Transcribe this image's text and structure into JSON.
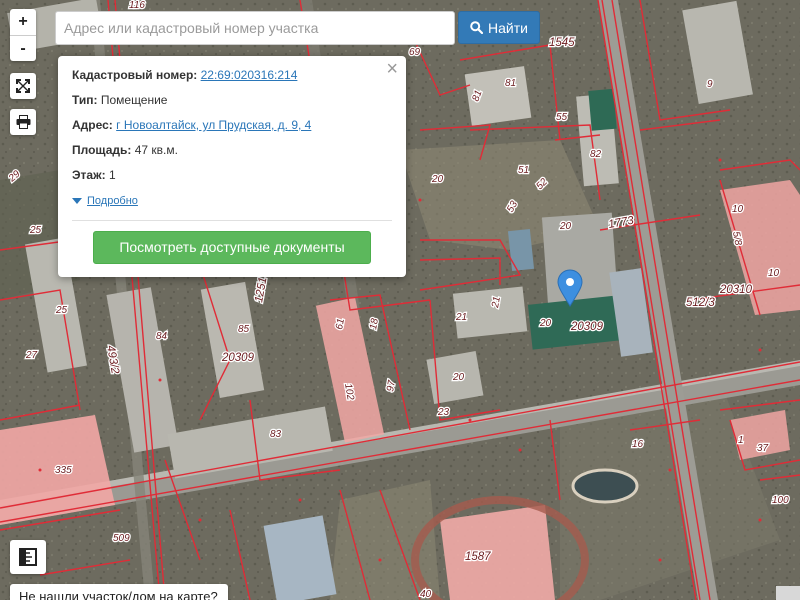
{
  "map": {
    "parcel_labels": [
      {
        "text": "116"
      },
      {
        "text": "1545"
      },
      {
        "text": "69"
      },
      {
        "text": "81"
      },
      {
        "text": "81"
      },
      {
        "text": "55"
      },
      {
        "text": "82"
      },
      {
        "text": "9"
      },
      {
        "text": "29"
      },
      {
        "text": "25"
      },
      {
        "text": "51"
      },
      {
        "text": "52"
      },
      {
        "text": "20"
      },
      {
        "text": "53"
      },
      {
        "text": "20"
      },
      {
        "text": "1773"
      },
      {
        "text": "10"
      },
      {
        "text": "5/8"
      },
      {
        "text": "10"
      },
      {
        "text": "20310"
      },
      {
        "text": "512/3"
      },
      {
        "text": "25"
      },
      {
        "text": "84"
      },
      {
        "text": "493/2"
      },
      {
        "text": "85"
      },
      {
        "text": "1251"
      },
      {
        "text": "61"
      },
      {
        "text": "18"
      },
      {
        "text": "21"
      },
      {
        "text": "21"
      },
      {
        "text": "20"
      },
      {
        "text": "20309"
      },
      {
        "text": "27"
      },
      {
        "text": "20309"
      },
      {
        "text": "102"
      },
      {
        "text": "97"
      },
      {
        "text": "20"
      },
      {
        "text": "23"
      },
      {
        "text": "83"
      },
      {
        "text": "16"
      },
      {
        "text": "1"
      },
      {
        "text": "37"
      },
      {
        "text": "335"
      },
      {
        "text": "509"
      },
      {
        "text": "1587"
      },
      {
        "text": "100"
      },
      {
        "text": "40"
      }
    ]
  },
  "controls": {
    "zoom_in": "+",
    "zoom_out": "-",
    "fullscreen_icon": "expand-icon",
    "print_icon": "printer-icon",
    "ruler_icon": "ruler-icon"
  },
  "search": {
    "placeholder": "Адрес или кадастровый номер участка",
    "value": "",
    "button_label": "Найти",
    "button_icon": "search-icon"
  },
  "popup": {
    "cadastral_label": "Кадастровый номер:",
    "cadastral_value": "22:69:020316:214",
    "type_label": "Тип:",
    "type_value": "Помещение",
    "address_label": "Адрес:",
    "address_value": "г Новоалтайск, ул Прудская, д. 9, 4",
    "area_label": "Площадь:",
    "area_value": "47 кв.м.",
    "floor_label": "Этаж:",
    "floor_value": "1",
    "more_label": "Подробно",
    "docs_button": "Посмотреть доступные документы",
    "close_symbol": "×"
  },
  "bottom": {
    "not_found_text": "Не нашли участок/дом на карте?"
  },
  "colors": {
    "primary": "#337ab7",
    "success": "#5cb85c",
    "parcel_line": "#d9303a",
    "marker": "#3d8fe0"
  }
}
